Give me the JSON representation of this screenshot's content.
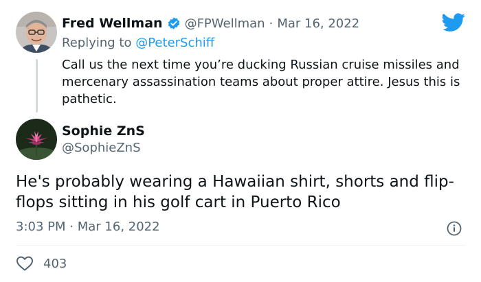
{
  "colors": {
    "accent": "#1d9bf0",
    "text": "#0f1419",
    "muted": "#536471",
    "divider": "#eff3f4",
    "verified": "#1d9bf0"
  },
  "reply_tweet": {
    "display_name": "Fred Wellman",
    "handle": "@FPWellman",
    "separator": "·",
    "date": "Mar 16, 2022",
    "replying_label": "Replying to",
    "replying_handle": "@PeterSchiff",
    "text": "Call us the next time you’re ducking Russian cruise missiles and mercenary assassination teams about proper attire. Jesus this is pathetic.",
    "verified_icon": "verified-badge-icon"
  },
  "main_tweet": {
    "display_name": "Sophie ZnS",
    "handle": "@SophieZnS",
    "text": "He's probably wearing a Hawaiian shirt, shorts and flip-flops sitting in his golf cart in Puerto Rico",
    "time": "3:03 PM",
    "separator": "·",
    "date": "Mar 16, 2022",
    "like_count": "403",
    "info_icon": "info-icon",
    "like_icon": "heart-icon"
  },
  "brand_icon": "twitter-bird-icon"
}
